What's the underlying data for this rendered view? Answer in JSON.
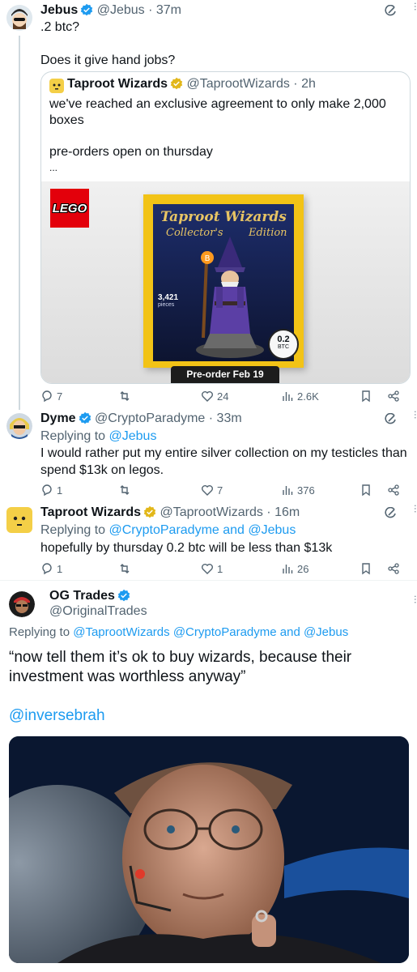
{
  "tweets": [
    {
      "name": "Jebus",
      "handle": "@Jebus · 37m",
      "lines": [
        ".2 btc?",
        "",
        "Does it give hand jobs?"
      ],
      "actions": {
        "replies": "7",
        "retweets": "",
        "likes": "24",
        "views": "2.6K"
      }
    },
    {
      "name": "Dyme",
      "handle": "@CryptoParadyme · 33m",
      "replying_prefix": "Replying to ",
      "replying_to": "@Jebus",
      "lines": [
        "I would rather put my entire silver collection on my testicles than",
        "spend $13k on legos."
      ],
      "actions": {
        "replies": "1",
        "retweets": "",
        "likes": "7",
        "views": "376"
      }
    },
    {
      "name": "Taproot Wizards",
      "handle": "@TaprootWizards · 16m",
      "replying_prefix": "Replying to ",
      "replying_to": "@CryptoParadyme and @Jebus",
      "lines": [
        "hopefully by thursday 0.2 btc will be less than $13k"
      ],
      "actions": {
        "replies": "1",
        "retweets": "",
        "likes": "1",
        "views": "26"
      }
    }
  ],
  "quote": {
    "name": "Taproot Wizards",
    "handle": "@TaprootWizards · 2h",
    "lines": [
      "we've reached an exclusive agreement to only make 2,000",
      "boxes",
      "",
      "pre-orders open on thursday",
      "..."
    ],
    "image": {
      "lego": "LEGO",
      "box_title": "Taproot Wizards",
      "box_subtitle": "Collector's",
      "box_edition": "Edition",
      "pieces_count": "3,421",
      "pieces_label": "pieces",
      "price_top": "0.2",
      "price_bottom": "BTC",
      "preorder": "Pre-order Feb 19",
      "btc_symbol": "B"
    }
  },
  "main": {
    "name": "OG Trades",
    "handle": "@OriginalTrades",
    "replying_prefix": "Replying to ",
    "replying_to": "@TaprootWizards @CryptoParadyme and @Jebus",
    "quote_line1": "“now tell them it’s ok to buy wizards, because their",
    "quote_line2": "investment was worthless anyway”",
    "mention": "@inversebrah"
  },
  "colors": {
    "accent": "#1d9bf0",
    "verified_gold": "#e2b719",
    "text": "#0f1419",
    "muted": "#536471"
  }
}
